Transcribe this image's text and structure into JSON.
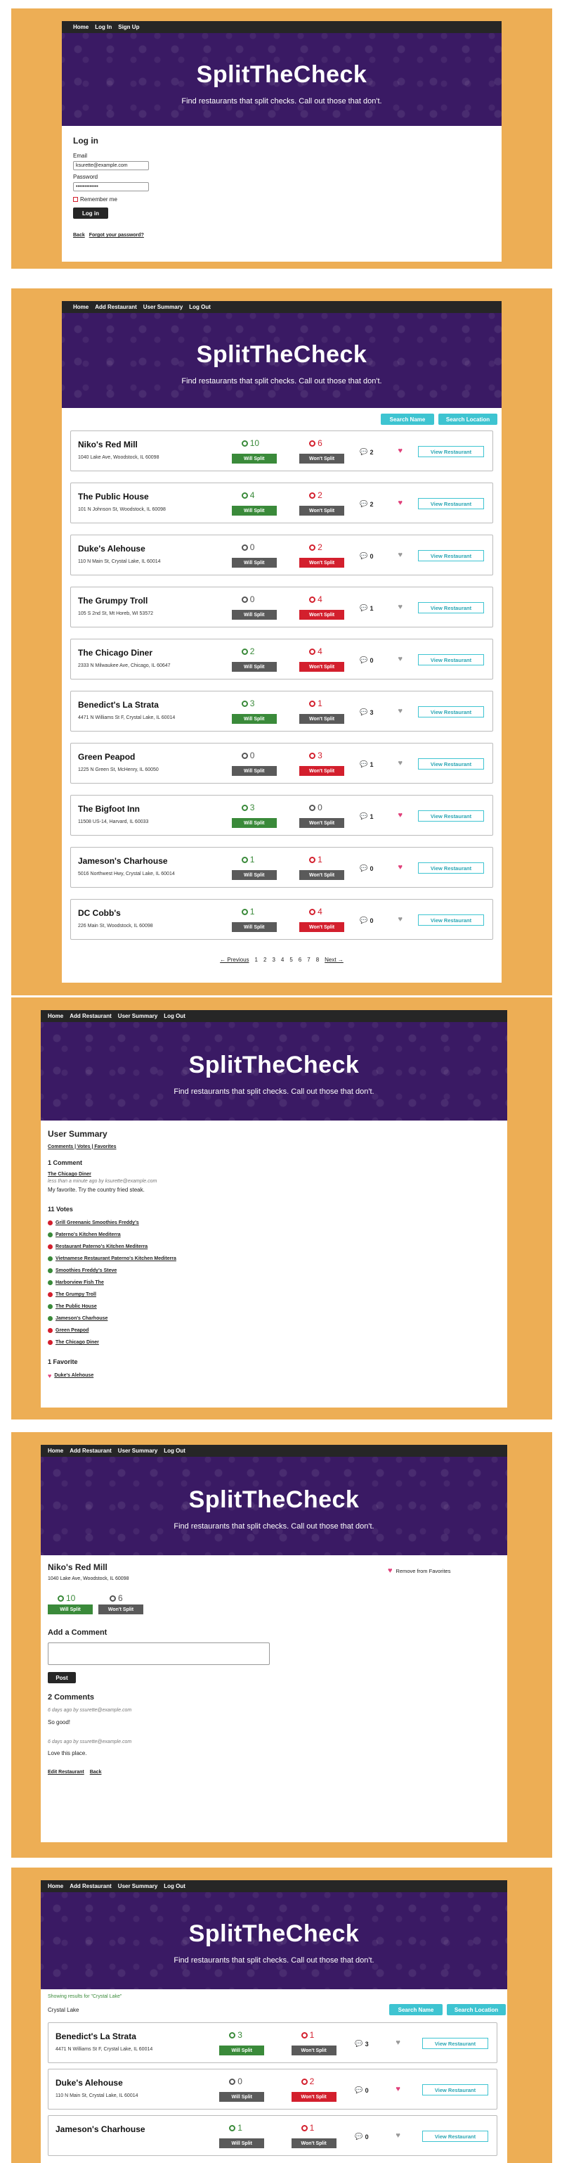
{
  "brand": {
    "title": "SplitTheCheck",
    "tagline": "Find restaurants that split checks. Call out those that don't."
  },
  "nav_guest": [
    "Home",
    "Log In",
    "Sign Up"
  ],
  "nav_user": [
    "Home",
    "Add Restaurant",
    "User Summary",
    "Log Out"
  ],
  "login": {
    "heading": "Log in",
    "email_label": "Email",
    "email_value": "ksurette@example.com",
    "password_label": "Password",
    "password_value": "•••••••••••••",
    "remember_label": "Remember me",
    "submit": "Log in",
    "back": "Back",
    "forgot": "Forgot your password?"
  },
  "list": {
    "search_name": "Search Name",
    "search_location": "Search Location",
    "will_split": "Will Split",
    "wont_split": "Won't Split",
    "view": "View Restaurant",
    "restaurants": [
      {
        "name": "Niko's Red Mill",
        "address": "1040 Lake Ave, Woodstock, IL 60098",
        "yes": "10",
        "no": "6",
        "comments": "2",
        "fav": true
      },
      {
        "name": "The Public House",
        "address": "101 N Johnson St, Woodstock, IL 60098",
        "yes": "4",
        "no": "2",
        "comments": "2",
        "fav": true
      },
      {
        "name": "Duke's Alehouse",
        "address": "110 N Main St, Crystal Lake, IL 60014",
        "yes": "0",
        "no": "2",
        "comments": "0",
        "fav": false
      },
      {
        "name": "The Grumpy Troll",
        "address": "105 S 2nd St, Mt Horeb, WI 53572",
        "yes": "0",
        "no": "4",
        "comments": "1",
        "fav": false
      },
      {
        "name": "The Chicago Diner",
        "address": "2333 N Milwaukee Ave, Chicago, IL 60647",
        "yes": "2",
        "no": "4",
        "comments": "0",
        "fav": false
      },
      {
        "name": "Benedict's La Strata",
        "address": "4471 N Williams St F, Crystal Lake, IL 60014",
        "yes": "3",
        "no": "1",
        "comments": "3",
        "fav": false
      },
      {
        "name": "Green Peapod",
        "address": "1225 N Green St, McHenry, IL 60050",
        "yes": "0",
        "no": "3",
        "comments": "1",
        "fav": false
      },
      {
        "name": "The Bigfoot Inn",
        "address": "11508 US-14, Harvard, IL 60033",
        "yes": "3",
        "no": "0",
        "comments": "1",
        "fav": true
      },
      {
        "name": "Jameson's Charhouse",
        "address": "5016 Northwest Hwy, Crystal Lake, IL 60014",
        "yes": "1",
        "no": "1",
        "comments": "0",
        "fav": true
      },
      {
        "name": "DC Cobb's",
        "address": "226 Main St, Woodstock, IL 60098",
        "yes": "1",
        "no": "4",
        "comments": "0",
        "fav": false
      }
    ],
    "pagination": [
      "← Previous",
      "1",
      "2",
      "3",
      "4",
      "5",
      "6",
      "7",
      "8",
      "Next →"
    ]
  },
  "summary": {
    "heading": "User Summary",
    "tabs": "Comments | Votes | Favorites",
    "comments_h": "1 Comment",
    "comment_place": "The Chicago Diner",
    "comment_meta": "less than a minute ago by ksurette@example.com",
    "comment_text": "My favorite. Try the country fried steak.",
    "votes_h": "11 Votes",
    "votes": [
      {
        "t": "Grill Greenanic Smoothies Freddy's",
        "c": "#d31f2d"
      },
      {
        "t": "Paterno's Kitchen Mediterra",
        "c": "#3a8a3a"
      },
      {
        "t": "Restaurant Paterno's Kitchen Mediterra",
        "c": "#d31f2d"
      },
      {
        "t": "Vietnamese Restaurant Paterno's Kitchen Mediterra",
        "c": "#3a8a3a"
      },
      {
        "t": "Smoothies Freddy's Steve",
        "c": "#3a8a3a"
      },
      {
        "t": "Harborview Fish The",
        "c": "#3a8a3a"
      },
      {
        "t": "The Grumpy Troll",
        "c": "#d31f2d"
      },
      {
        "t": "The Public House",
        "c": "#3a8a3a"
      },
      {
        "t": "Jameson's Charhouse",
        "c": "#3a8a3a"
      },
      {
        "t": "Green Peapod",
        "c": "#d31f2d"
      },
      {
        "t": "The Chicago Diner",
        "c": "#d31f2d"
      }
    ],
    "fav_h": "1 Favorite",
    "fav": "Duke's Alehouse"
  },
  "detail": {
    "name": "Niko's Red Mill",
    "address": "1040 Lake Ave, Woodstock, IL 60098",
    "yes": "10",
    "no": "6",
    "remove_fav": "Remove from Favorites",
    "add_comment": "Add a Comment",
    "post": "Post",
    "comments_h": "2 Comments",
    "comments": [
      {
        "meta": "6 days ago by ssurette@example.com",
        "text": "So good!"
      },
      {
        "meta": "6 days ago by ssurette@example.com",
        "text": "Love this place."
      }
    ],
    "edit": "Edit Restaurant",
    "back": "Back"
  },
  "search": {
    "notice": "Showing results for \"Crystal Lake\"",
    "query": "Crystal Lake",
    "results": [
      {
        "name": "Benedict's La Strata",
        "address": "4471 N Williams St F, Crystal Lake, IL 60014",
        "yes": "3",
        "no": "1",
        "comments": "3",
        "fav": false
      },
      {
        "name": "Duke's Alehouse",
        "address": "110 N Main St, Crystal Lake, IL 60014",
        "yes": "0",
        "no": "2",
        "comments": "0",
        "fav": true
      },
      {
        "name": "Jameson's Charhouse",
        "address": "",
        "yes": "1",
        "no": "1",
        "comments": "0",
        "fav": false
      }
    ]
  },
  "colors": {
    "panel": "#edae55",
    "hero": "#3a1a64",
    "green": "#3a8a3a",
    "red": "#d31f2d",
    "teal": "#3ec4d1"
  }
}
